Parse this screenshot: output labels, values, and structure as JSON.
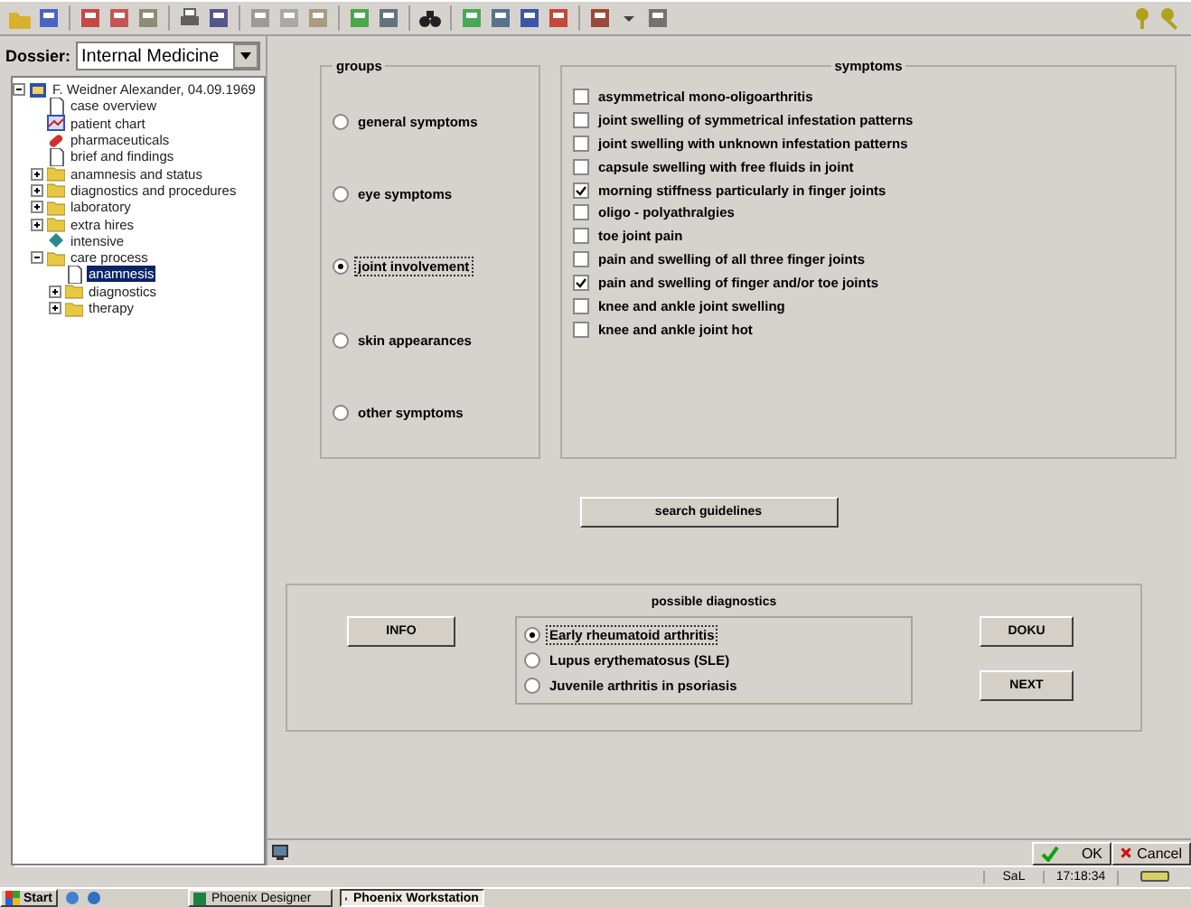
{
  "dossier": {
    "label": "Dossier:",
    "value": "Internal Medicine"
  },
  "tree": [
    {
      "label": "F. Weidner Alexander, 04.09.1969",
      "kind": "patient",
      "expanded": true,
      "selected": false,
      "children": [
        {
          "label": "case overview",
          "kind": "doc",
          "selected": false
        },
        {
          "label": "patient chart",
          "kind": "chart",
          "selected": false
        },
        {
          "label": "pharmaceuticals",
          "kind": "pills",
          "selected": false
        },
        {
          "label": "brief and findings",
          "kind": "doc",
          "selected": false
        },
        {
          "label": "anamnesis and status",
          "kind": "folder",
          "expanded": false,
          "selected": false
        },
        {
          "label": "diagnostics and procedures",
          "kind": "folder",
          "expanded": false,
          "selected": false
        },
        {
          "label": "laboratory",
          "kind": "folder",
          "expanded": false,
          "selected": false
        },
        {
          "label": "extra hires",
          "kind": "folder",
          "expanded": false,
          "selected": false
        },
        {
          "label": "intensive",
          "kind": "book",
          "selected": false
        },
        {
          "label": "care process",
          "kind": "folder",
          "expanded": true,
          "selected": false,
          "children": [
            {
              "label": "anamnesis",
              "kind": "doc",
              "selected": true
            },
            {
              "label": "diagnostics",
              "kind": "folder",
              "expanded": false,
              "selected": false
            },
            {
              "label": "therapy",
              "kind": "folder",
              "expanded": false,
              "selected": false
            }
          ]
        }
      ]
    }
  ],
  "groups": {
    "title": "groups",
    "items": [
      {
        "label": "general symptoms",
        "selected": false
      },
      {
        "label": "eye symptoms",
        "selected": false
      },
      {
        "label": "joint involvement",
        "selected": true
      },
      {
        "label": "skin appearances",
        "selected": false
      },
      {
        "label": "other symptoms",
        "selected": false
      }
    ]
  },
  "symptoms": {
    "title": "symptoms",
    "items": [
      {
        "label": "asymmetrical mono-oligoarthritis",
        "checked": false
      },
      {
        "label": "joint swelling of symmetrical infestation patterns",
        "checked": false
      },
      {
        "label": "joint swelling with unknown infestation patterns",
        "checked": false
      },
      {
        "label": "capsule swelling with free fluids in joint",
        "checked": false
      },
      {
        "label": "morning stiffness particularly in finger joints",
        "checked": true
      },
      {
        "label": "oligo - polyathralgies",
        "checked": false
      },
      {
        "label": "toe joint pain",
        "checked": false
      },
      {
        "label": "pain and swelling of all three finger joints",
        "checked": false
      },
      {
        "label": "pain and swelling of finger and/or toe joints",
        "checked": true
      },
      {
        "label": "knee and ankle joint swelling",
        "checked": false
      },
      {
        "label": "knee and ankle joint hot",
        "checked": false
      }
    ]
  },
  "search_button": "search guidelines",
  "diagnostics": {
    "title": "possible diagnostics",
    "info_button": "INFO",
    "doku_button": "DOKU",
    "next_button": "NEXT",
    "items": [
      {
        "label": "Early rheumatoid arthritis",
        "selected": true
      },
      {
        "label": "Lupus erythematosus (SLE)",
        "selected": false
      },
      {
        "label": "Juvenile arthritis in psoriasis",
        "selected": false
      }
    ]
  },
  "ok_button": "OK",
  "cancel_button": "Cancel",
  "status_bar": {
    "user": "SaL",
    "time": "17:18:34"
  },
  "taskbar": {
    "start": "Start",
    "tasks": [
      {
        "label": "Phoenix Designer",
        "selected": false
      },
      {
        "label": "Phoenix Workstation",
        "selected": true
      }
    ]
  }
}
